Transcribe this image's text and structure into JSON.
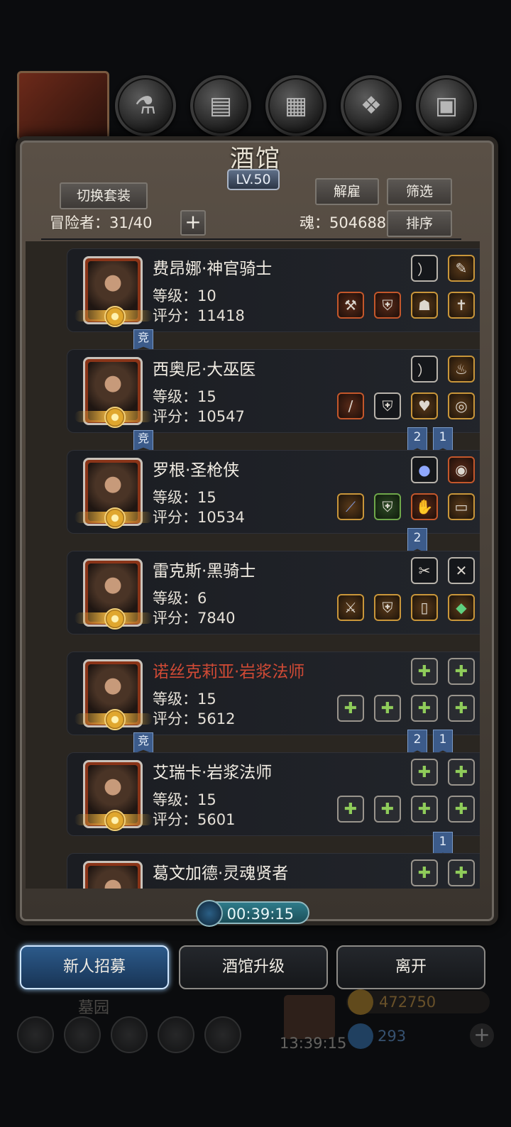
{
  "header": {
    "title": "酒馆",
    "level": "LV.50",
    "switch_outfit": "切换套装",
    "dismiss": "解雇",
    "filter": "筛选",
    "sort": "排序",
    "adventurer_count": "冒险者：31/40",
    "add_symbol": "+",
    "soul": "魂：504688"
  },
  "heroes": [
    {
      "name": "费昂娜·神官骑士",
      "level": "等级：10",
      "score": "评分：11418",
      "red": false
    },
    {
      "name": "西奥尼·大巫医",
      "level": "等级：15",
      "score": "评分：10547",
      "red": false
    },
    {
      "name": "罗根·圣枪侠",
      "level": "等级：15",
      "score": "评分：10534",
      "red": false
    },
    {
      "name": "雷克斯·黑骑士",
      "level": "等级：6",
      "score": "评分：7840",
      "red": false
    },
    {
      "name": "诺丝克莉亚·岩浆法师",
      "level": "等级：15",
      "score": "评分：5612",
      "red": true
    },
    {
      "name": "艾瑞卡·岩浆法师",
      "level": "等级：15",
      "score": "评分：5601",
      "red": false
    },
    {
      "name": "葛文加德·灵魂贤者",
      "level": "",
      "score": "",
      "red": false
    }
  ],
  "markers": {
    "jing": "竞",
    "flag_1": "1",
    "flag_2": "2"
  },
  "timer": "00:39:15",
  "actions": {
    "recruit": "新人招募",
    "upgrade": "酒馆升级",
    "leave": "离开"
  },
  "background_ui": {
    "location": "墓园",
    "gold": "472750",
    "gems": "293",
    "gift_timer": "13:39:15"
  }
}
